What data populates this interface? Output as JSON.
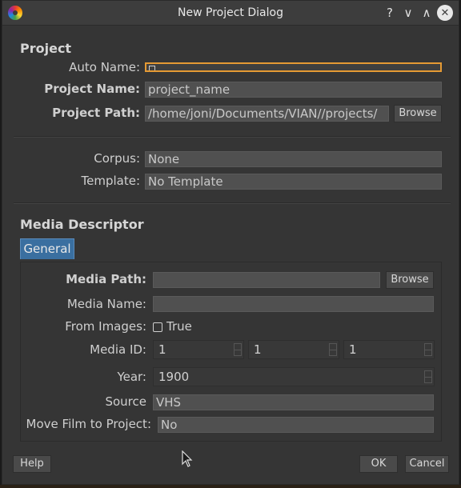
{
  "window": {
    "title": "New Project Dialog"
  },
  "titlebar_buttons": {
    "help": "?",
    "minimize": "∨",
    "maximize": "∧",
    "close": "✕"
  },
  "project": {
    "heading": "Project",
    "auto_name_label": "Auto Name:",
    "project_name_label": "Project Name:",
    "project_name_value": "project_name",
    "project_path_label": "Project Path:",
    "project_path_value": "/home/joni/Documents/VIAN//projects/",
    "browse_label": "Browse",
    "corpus_label": "Corpus:",
    "corpus_value": "None",
    "template_label": "Template:",
    "template_value": "No Template"
  },
  "media": {
    "heading": "Media Descriptor",
    "tab_general": "General",
    "media_path_label": "Media Path:",
    "media_path_value": "",
    "browse_label": "Browse",
    "media_name_label": "Media Name:",
    "media_name_value": "",
    "from_images_label": "From Images:",
    "from_images_checkbox_label": "True",
    "media_id_label": "Media ID:",
    "media_id_values": [
      "1",
      "1",
      "1"
    ],
    "year_label": "Year:",
    "year_value": "1900",
    "source_label": "Source",
    "source_value": "VHS",
    "move_film_label": "Move Film to Project:",
    "move_film_value": "No"
  },
  "footer": {
    "help_label": "Help",
    "ok_label": "OK",
    "cancel_label": "Cancel"
  },
  "colors": {
    "focus_border": "#e59a34",
    "tab_active": "#3a6fa0",
    "background": "#353535"
  }
}
